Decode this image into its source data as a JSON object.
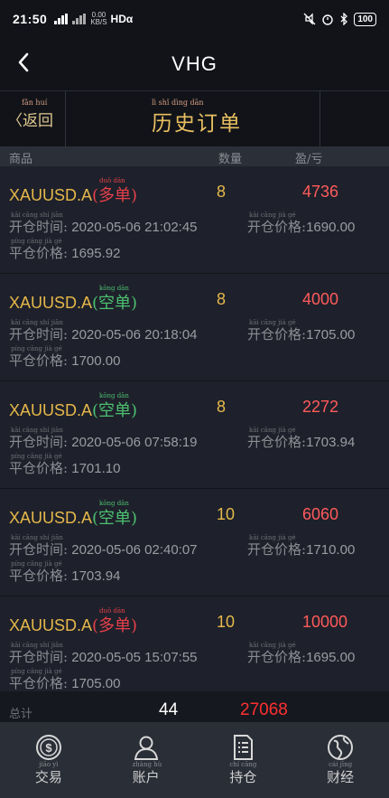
{
  "status_bar": {
    "time": "21:50",
    "net_speed": "0.00\nKB/S",
    "hd": "HDα",
    "battery": "100"
  },
  "header": {
    "title": "VHG"
  },
  "tabs": {
    "back_label": "〈返回",
    "back_pinyin": "fǎn huí",
    "title": "历史订单",
    "title_pinyin": "lì  shǐ  dìng  dān"
  },
  "columns": {
    "product": "商品",
    "quantity": "数量",
    "pnl": "盈/亏"
  },
  "labels": {
    "open_time": "开仓时间:",
    "open_time_pinyin": "kāi cāng shí jiān",
    "open_price": "开仓价格:",
    "open_price_pinyin": "kāi cāng jià gé",
    "close_price": "平仓价格:",
    "close_price_pinyin": "píng cāng jià gé"
  },
  "orders": [
    {
      "symbol": "XAUUSD.A",
      "direction": "(多单)",
      "direction_pinyin": "duō dān",
      "direction_type": "buy",
      "quantity": "8",
      "pnl": "4736",
      "open_time": "2020-05-06 21:02:45",
      "open_price": "1690.00",
      "close_price": "1695.92"
    },
    {
      "symbol": "XAUUSD.A",
      "direction": "(空单)",
      "direction_pinyin": "kōng dān",
      "direction_type": "sell",
      "quantity": "8",
      "pnl": "4000",
      "open_time": "2020-05-06 20:18:04",
      "open_price": "1705.00",
      "close_price": "1700.00"
    },
    {
      "symbol": "XAUUSD.A",
      "direction": "(空单)",
      "direction_pinyin": "kōng dān",
      "direction_type": "sell",
      "quantity": "8",
      "pnl": "2272",
      "open_time": "2020-05-06 07:58:19",
      "open_price": "1703.94",
      "close_price": "1701.10"
    },
    {
      "symbol": "XAUUSD.A",
      "direction": "(空单)",
      "direction_pinyin": "kōng dān",
      "direction_type": "sell",
      "quantity": "10",
      "pnl": "6060",
      "open_time": "2020-05-06 02:40:07",
      "open_price": "1710.00",
      "close_price": "1703.94"
    },
    {
      "symbol": "XAUUSD.A",
      "direction": "(多单)",
      "direction_pinyin": "duō dān",
      "direction_type": "buy",
      "quantity": "10",
      "pnl": "10000",
      "open_time": "2020-05-05 15:07:55",
      "open_price": "1695.00",
      "close_price": "1705.00"
    }
  ],
  "total": {
    "label": "总计",
    "quantity": "44",
    "pnl": "27068"
  },
  "bottom_nav": [
    {
      "label": "交易",
      "pinyin": "jiāo yì",
      "icon": "dollar-circle-icon"
    },
    {
      "label": "账户",
      "pinyin": "zhàng hù",
      "icon": "user-icon"
    },
    {
      "label": "持仓",
      "pinyin": "chí cāng",
      "icon": "document-list-icon"
    },
    {
      "label": "财经",
      "pinyin": "cái jīng",
      "icon": "globe-icon"
    }
  ],
  "colors": {
    "gold": "#e6b84a",
    "red": "#ff5a5a",
    "green": "#4cc070",
    "background": "#1e212b"
  }
}
